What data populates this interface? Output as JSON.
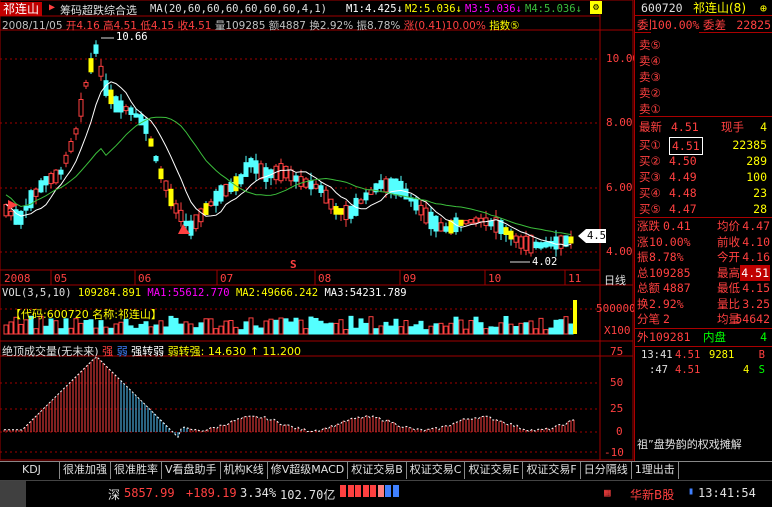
{
  "header": {
    "stock_name": "祁连山",
    "indicator_name": "筹码超跌综合选",
    "ma_params": "MA(20,60,60,60,60,60,60,4,1)",
    "m1": "M1:4.425↓",
    "m2": "M2:5.036↓",
    "m3": "M3:5.036↓",
    "m4": "M4:5.036↓",
    "date": "2008/11/05",
    "open": "开4.16",
    "high": "高4.51",
    "low": "低4.15",
    "close": "收4.51",
    "volume": "量109285",
    "amount": "额4887",
    "turnover": "换2.92%",
    "amplitude": "振8.78%",
    "change": "涨(0.41)10.00%",
    "index_label": "指数⑤"
  },
  "price_axis": [
    "10.00",
    "8.00",
    "6.00",
    "4.00"
  ],
  "annotations": {
    "high_label": "10.66",
    "low_label": "4.02",
    "current_price": "4.51",
    "s_marker": "S"
  },
  "time_axis": [
    "2008",
    "05",
    "06",
    "07",
    "08",
    "09",
    "10",
    "11"
  ],
  "period_label": "日线",
  "volume_panel": {
    "title": "VOL(3,5,10)",
    "value": "109284.891",
    "ma1": "MA1:55612.770",
    "ma2": "MA2:49666.242",
    "ma3": "MA3:54231.789",
    "overlay": "【代码:600720  名称:祁连山】",
    "axis": [
      "500000",
      "X100"
    ]
  },
  "indicator_panel": {
    "title": "绝顶成交量(无未来)",
    "strong": "强",
    "weak": "弱",
    "strong_weak": "强转弱",
    "weak_strong": "弱转强:",
    "value1": "14.630",
    "value2": "11.200",
    "axis": [
      "75",
      "50",
      "25",
      "0",
      "-10"
    ]
  },
  "quote": {
    "code": "600720",
    "name": "祁连山(8)",
    "wei_bi": "100.00%",
    "wei_cha_label": "委差",
    "wei_cha": "22825",
    "sell": [
      "卖⑤",
      "卖④",
      "卖③",
      "卖②",
      "卖①"
    ],
    "latest_label": "最新",
    "latest": "4.51",
    "cur_vol_label": "现手",
    "cur_vol": "4",
    "buy": [
      {
        "label": "买①",
        "price": "4.51",
        "vol": "22385"
      },
      {
        "label": "买②",
        "price": "4.50",
        "vol": "289"
      },
      {
        "label": "买③",
        "price": "4.49",
        "vol": "100"
      },
      {
        "label": "买④",
        "price": "4.48",
        "vol": "23"
      },
      {
        "label": "买⑤",
        "price": "4.47",
        "vol": "28"
      }
    ],
    "stats": [
      {
        "l1": "涨跌",
        "v1": "0.41",
        "l2": "均价",
        "v2": "4.47"
      },
      {
        "l1": "涨",
        "v1": "10.00%",
        "l2": "前收",
        "v2": "4.10"
      },
      {
        "l1": "振",
        "v1": "8.78%",
        "l2": "今开",
        "v2": "4.16"
      },
      {
        "l1": "总",
        "v1": "109285",
        "l2": "最高",
        "v2": "4.51"
      },
      {
        "l1": "总额",
        "v1": "4887",
        "l2": "最低",
        "v2": "4.15"
      },
      {
        "l1": "换",
        "v1": "2.92%",
        "l2": "量比",
        "v2": "3.25"
      },
      {
        "l1": "分笔",
        "v1": "2",
        "l2": "均量",
        "v2": "54642"
      }
    ],
    "outer_label": "外",
    "outer": "109281",
    "inner_label": "内盘",
    "inner": "4",
    "tick1": {
      "time": "13:41",
      "price": "4.51",
      "vol": "9281",
      "side": "B"
    },
    "tick2": {
      "time": ":47",
      "price": "4.51",
      "vol": "4",
      "side": "S"
    },
    "side_tabs": "祖”盘势韵的权戏摊解"
  },
  "tabs": [
    "KDJ",
    "很准加强",
    "很准胜率",
    "V看盘助手",
    "机构K线",
    "修V超级MACD",
    "权证交易B",
    "权证交易C",
    "权证交易E",
    "权证交易F",
    "日分隔线",
    "1理出击"
  ],
  "status": {
    "market": "深",
    "index": "5857.99",
    "change": "+189.19",
    "pct": "3.34%",
    "amount": "102.70亿",
    "broker": "华新B股",
    "time": "13:41:54"
  },
  "colors": {
    "up": "#ff4040",
    "down": "#54ffff",
    "ma_white": "#ffffff",
    "ma_green": "#3cbf3c",
    "yellow": "#ffff00",
    "grid_red": "#a00000"
  }
}
